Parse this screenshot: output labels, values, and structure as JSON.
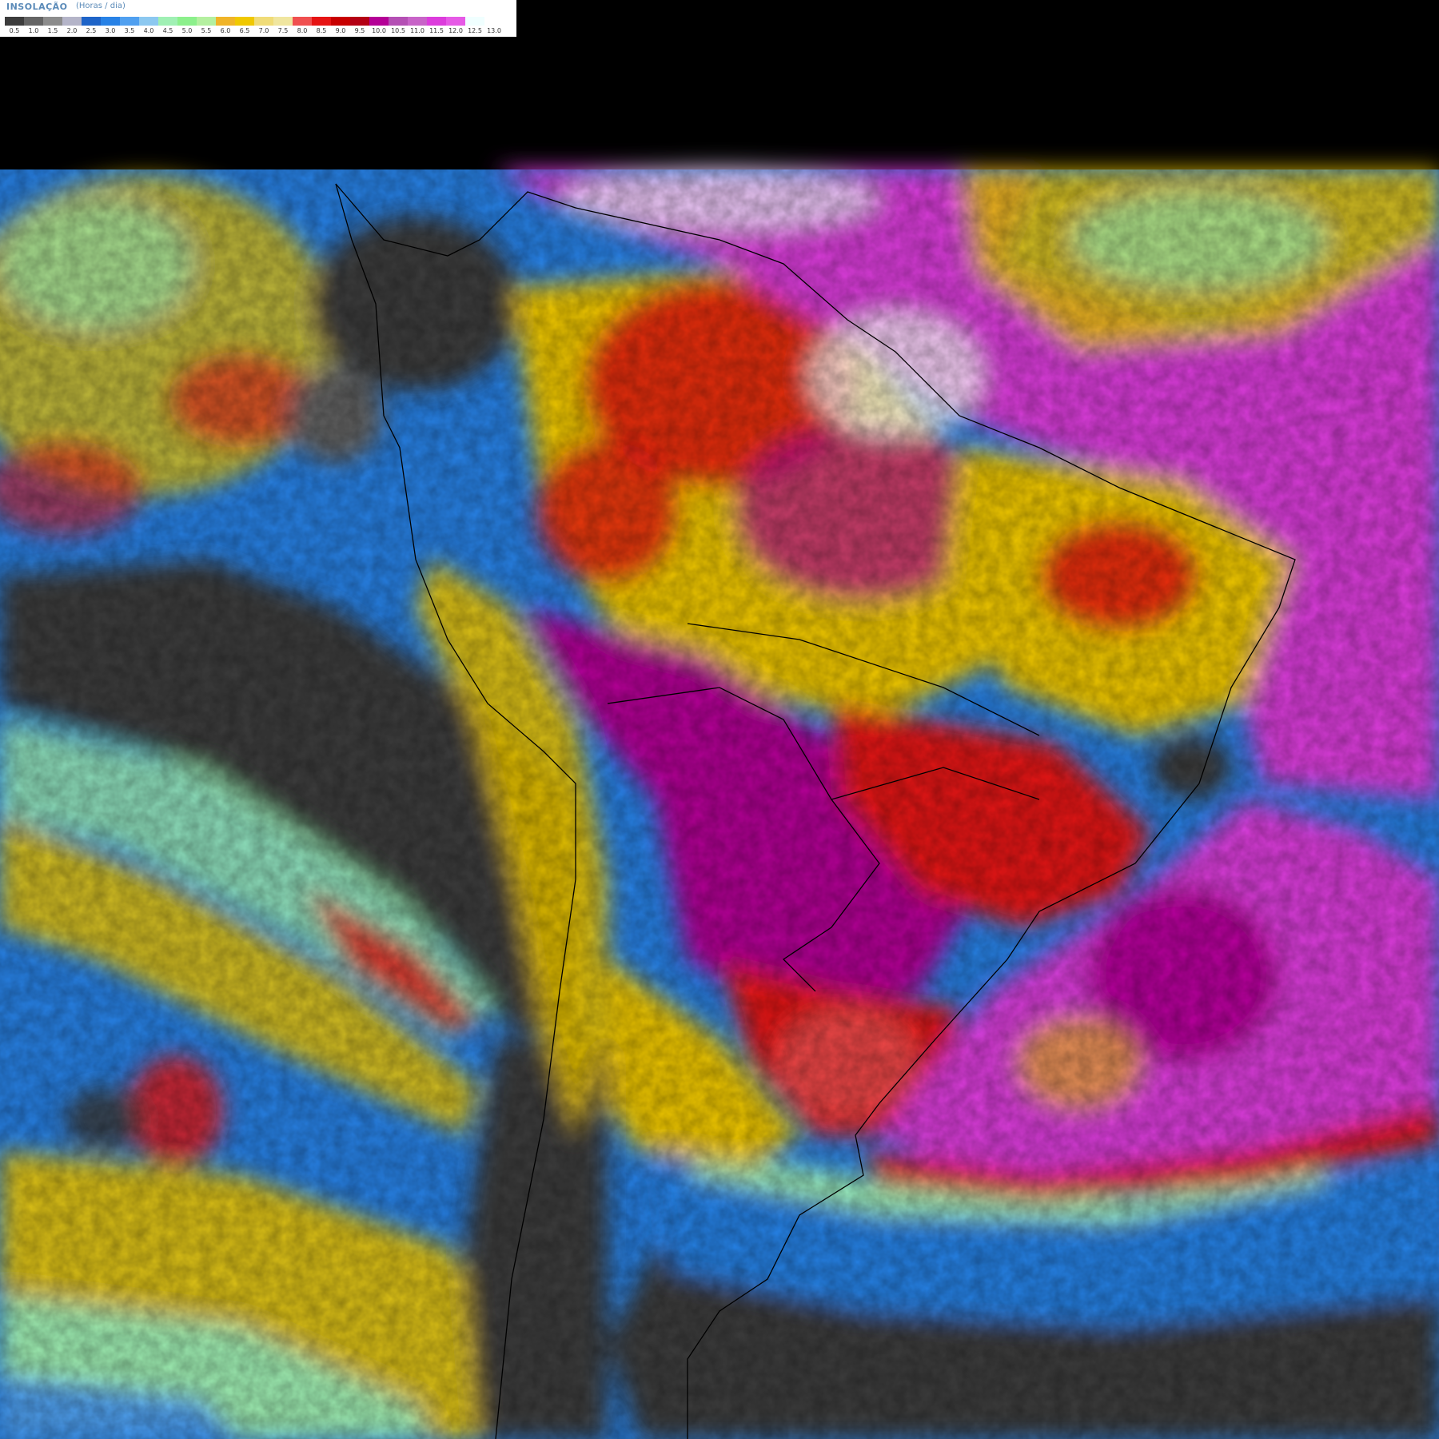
{
  "legend": {
    "title": "INSOLAÇÃO",
    "unit": "(Horas / dia)",
    "ticks": [
      "0.5",
      "1.0",
      "1.5",
      "2.0",
      "2.5",
      "3.0",
      "3.5",
      "4.0",
      "4.5",
      "5.0",
      "5.5",
      "6.0",
      "6.5",
      "7.0",
      "7.5",
      "8.0",
      "8.5",
      "9.0",
      "9.5",
      "10.0",
      "10.5",
      "11.0",
      "11.5",
      "12.0",
      "12.5",
      "13.0"
    ],
    "colors": [
      "#3c3c3c",
      "#646464",
      "#8c8c8c",
      "#b4b4c8",
      "#1e64c8",
      "#2882e6",
      "#50a0f0",
      "#8cc8f0",
      "#a0f0b4",
      "#8cf08c",
      "#b4f0a0",
      "#f0b428",
      "#f0c800",
      "#f0dc78",
      "#f0e6a0",
      "#f05050",
      "#e61414",
      "#c80000",
      "#b40014",
      "#b40096",
      "#b450b4",
      "#c864c8",
      "#dc3cdc",
      "#e65ae6",
      "#f0ffff",
      "#ffffff"
    ]
  },
  "map": {
    "colors": {
      "cloudy": "#3c3c3c",
      "low": "#2882e6",
      "mid": "#a0f0b4",
      "moderate": "#f0c800",
      "high": "#e61414",
      "very_high": "#b40096",
      "max": "#dc3cdc",
      "clear": "#ffffff",
      "nodata": "#000000"
    }
  }
}
